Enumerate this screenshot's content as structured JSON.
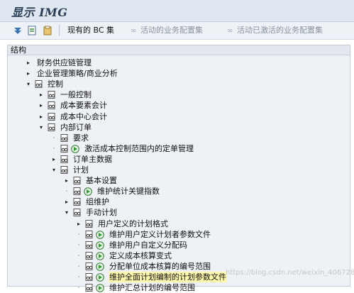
{
  "window": {
    "title": "显示 IMG"
  },
  "toolbar": {
    "current_bc_label": "现有的 BC 集",
    "active_projects_label": "活动的业务配置集",
    "activated_projects_label": "活动已激活的业务配置集"
  },
  "structure_header": "结构",
  "tree": [
    {
      "label": "财务供应链管理",
      "level": 1,
      "toggle": "▸",
      "folder": false,
      "exec": false
    },
    {
      "label": "企业管理策略/商业分析",
      "level": 1,
      "toggle": "▸",
      "folder": false,
      "exec": false
    },
    {
      "label": "控制",
      "level": 1,
      "toggle": "▾",
      "folder": true,
      "exec": false
    },
    {
      "label": "一般控制",
      "level": 2,
      "toggle": "▸",
      "folder": true,
      "exec": false
    },
    {
      "label": "成本要素会计",
      "level": 2,
      "toggle": "▸",
      "folder": true,
      "exec": false
    },
    {
      "label": "成本中心会计",
      "level": 2,
      "toggle": "▸",
      "folder": true,
      "exec": false
    },
    {
      "label": "内部订单",
      "level": 2,
      "toggle": "▾",
      "folder": true,
      "exec": false
    },
    {
      "label": "要求",
      "level": 3,
      "toggle": "·",
      "folder": true,
      "exec": false
    },
    {
      "label": "激活成本控制范围内的定单管理",
      "level": 3,
      "toggle": "·",
      "folder": true,
      "exec": true
    },
    {
      "label": "订单主数据",
      "level": 3,
      "toggle": "▸",
      "folder": true,
      "exec": false
    },
    {
      "label": "计划",
      "level": 3,
      "toggle": "▾",
      "folder": true,
      "exec": false
    },
    {
      "label": "基本设置",
      "level": 4,
      "toggle": "▸",
      "folder": true,
      "exec": false
    },
    {
      "label": "维护统计关键指数",
      "level": 4,
      "toggle": "·",
      "folder": true,
      "exec": true
    },
    {
      "label": "组维护",
      "level": 4,
      "toggle": "▸",
      "folder": true,
      "exec": false
    },
    {
      "label": "手动计划",
      "level": 4,
      "toggle": "▾",
      "folder": true,
      "exec": false
    },
    {
      "label": "用户定义的计划格式",
      "level": 5,
      "toggle": "▸",
      "folder": true,
      "exec": false
    },
    {
      "label": "维护用户定义计划者参数文件",
      "level": 5,
      "toggle": "·",
      "folder": true,
      "exec": true
    },
    {
      "label": "维护用户自定义分配码",
      "level": 5,
      "toggle": "·",
      "folder": true,
      "exec": true
    },
    {
      "label": "定义成本核算变式",
      "level": 5,
      "toggle": "·",
      "folder": true,
      "exec": true
    },
    {
      "label": "分配单位成本核算的编号范围",
      "level": 5,
      "toggle": "·",
      "folder": true,
      "exec": true
    },
    {
      "label": "维护全面计划编制的计划参数文件",
      "level": 5,
      "toggle": "·",
      "folder": true,
      "exec": true,
      "selected": true
    },
    {
      "label": "维护汇总计划的编号范围",
      "level": 5,
      "toggle": "·",
      "folder": true,
      "exec": true
    }
  ],
  "watermark": "https://blog.csdn.net/weixin_40672823"
}
